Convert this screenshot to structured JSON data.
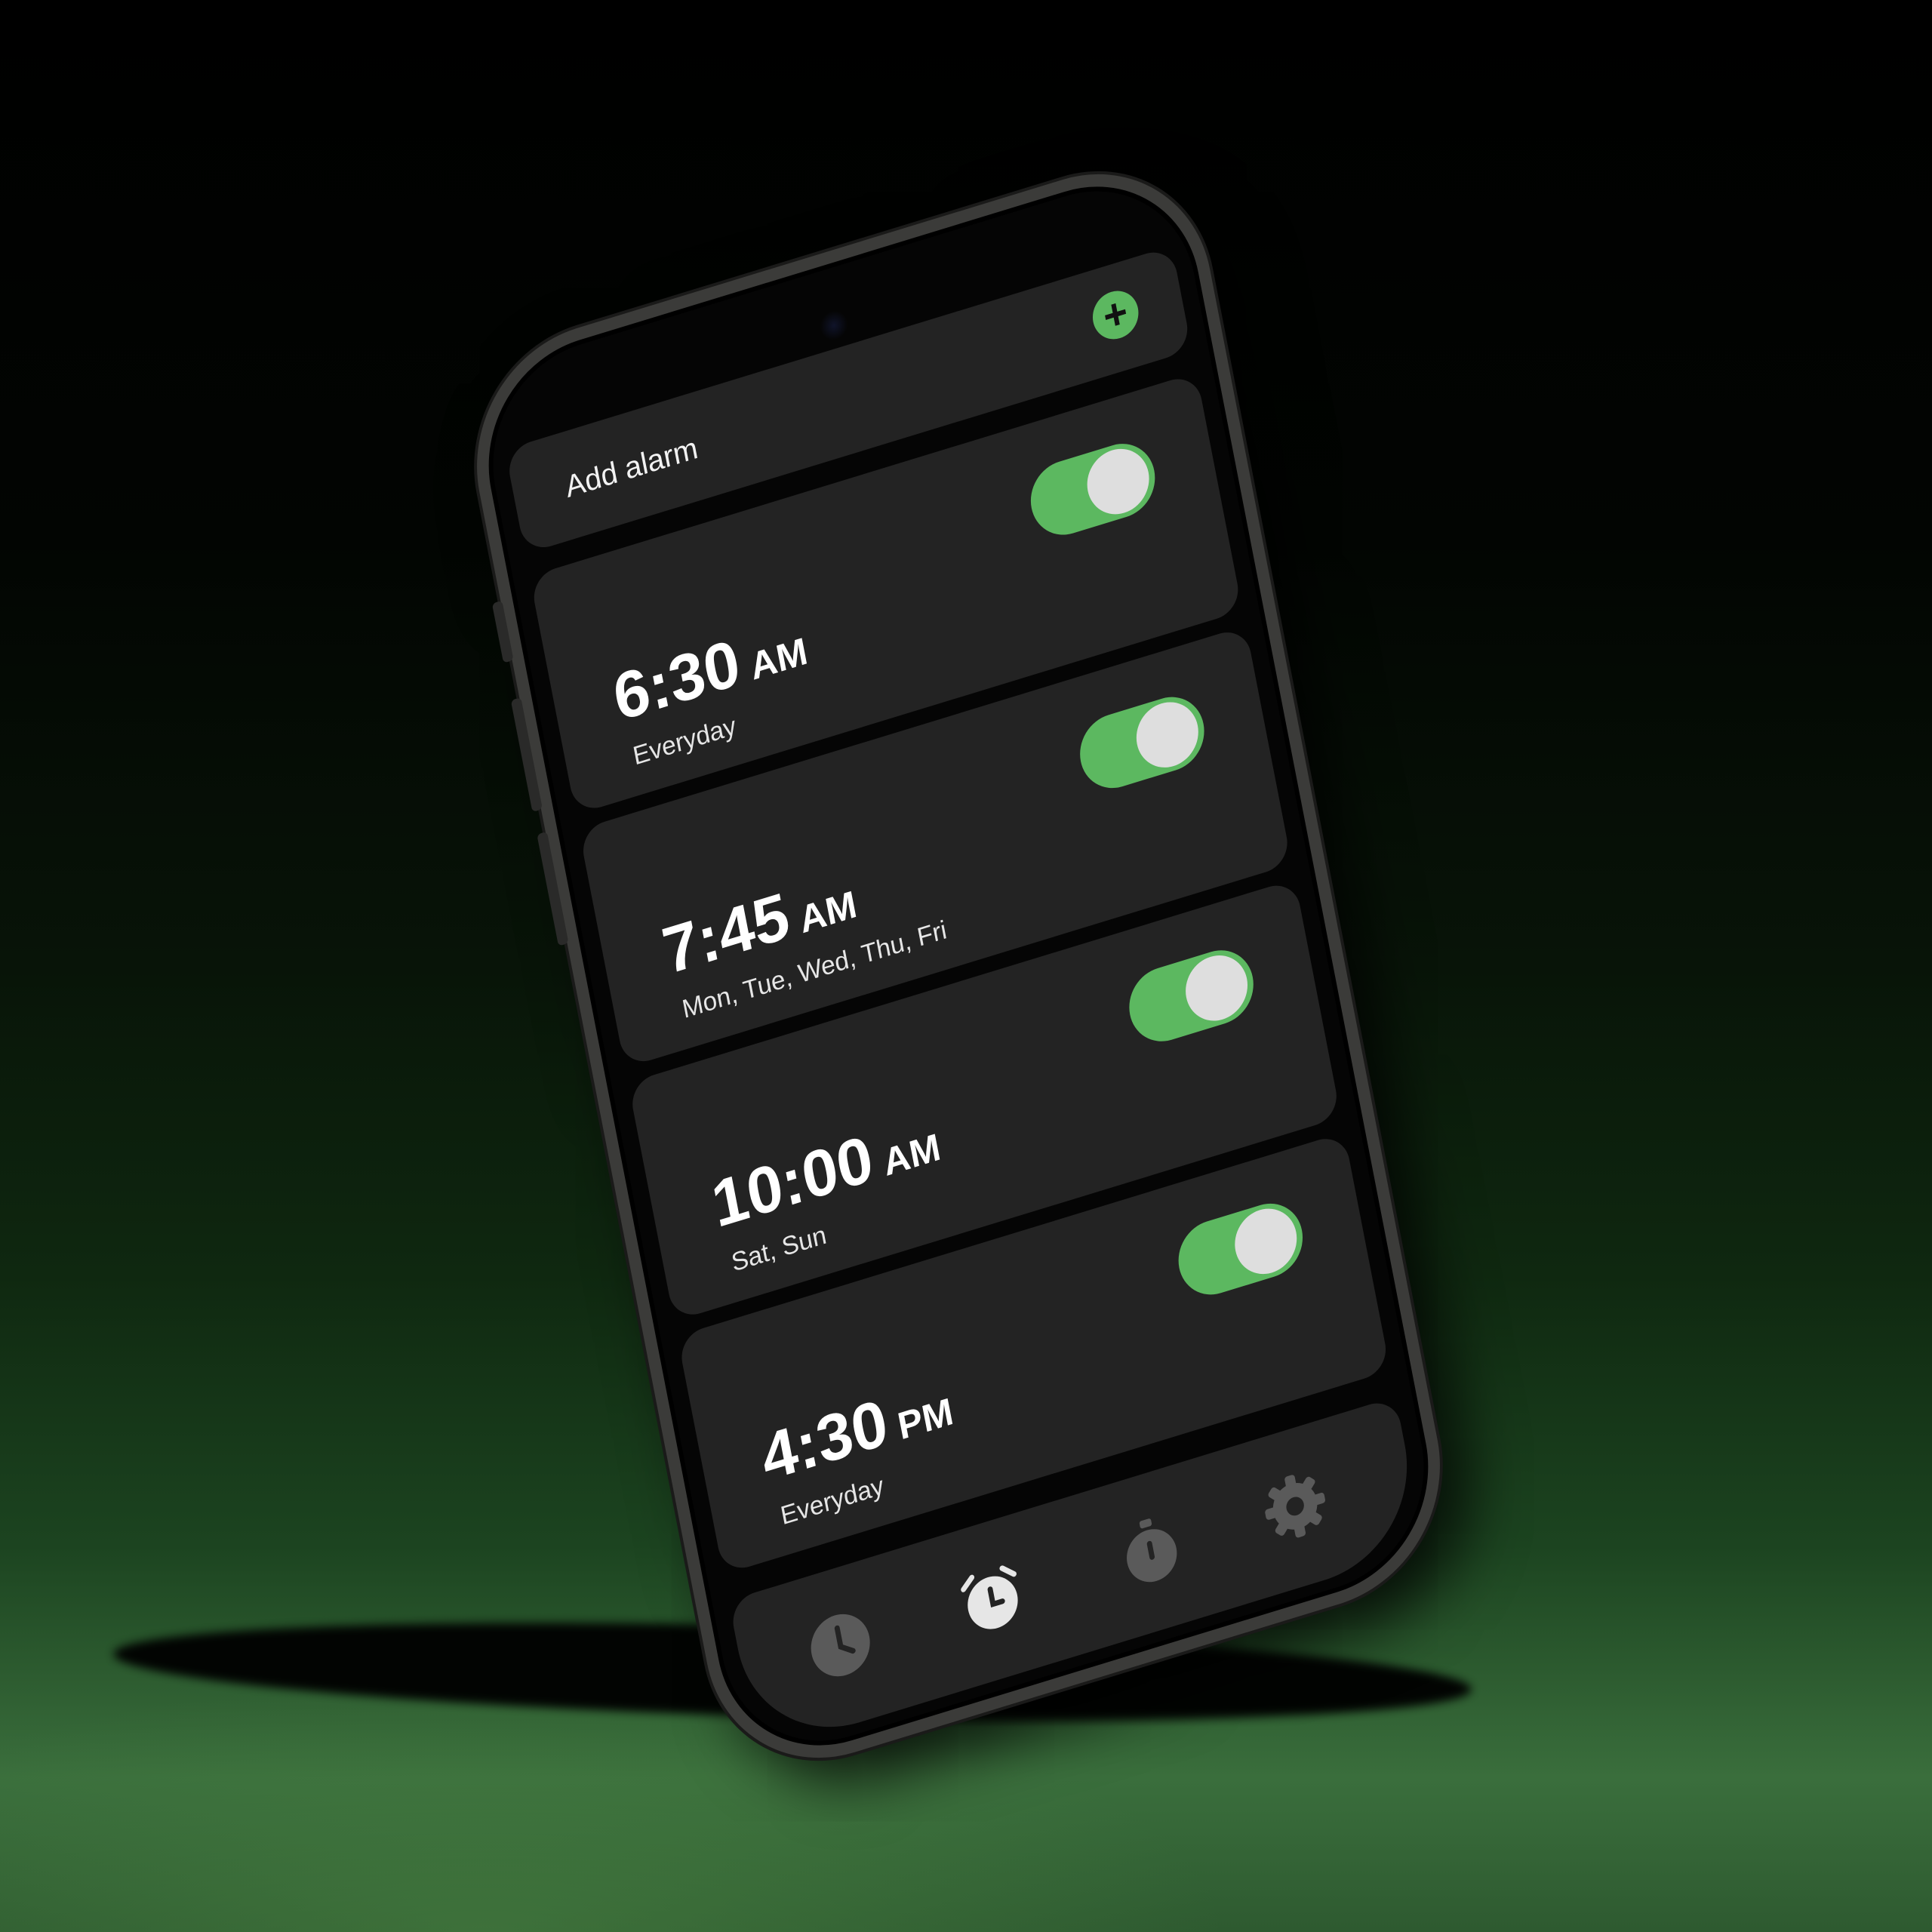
{
  "add_alarm": {
    "label": "Add alarm",
    "button_icon": "plus-icon"
  },
  "alarms": [
    {
      "time": "6:30",
      "period": "AM",
      "days": "Everyday",
      "enabled": true
    },
    {
      "time": "7:45",
      "period": "AM",
      "days": "Mon, Tue, Wed, Thu, Fri",
      "enabled": true
    },
    {
      "time": "10:00",
      "period": "AM",
      "days": "Sat, Sun",
      "enabled": true
    },
    {
      "time": "4:30",
      "period": "PM",
      "days": "Everyday",
      "enabled": true
    }
  ],
  "tabs": [
    {
      "icon": "clock-icon",
      "active": false
    },
    {
      "icon": "alarm-clock-icon",
      "active": true
    },
    {
      "icon": "stopwatch-icon",
      "active": false
    },
    {
      "icon": "gear-icon",
      "active": false
    }
  ],
  "colors": {
    "accent": "#5cb860",
    "card": "#232323",
    "screen": "#050505",
    "knob": "#dedede",
    "tab_active": "#e6e6e6",
    "tab_inactive": "#5a5a5a"
  }
}
